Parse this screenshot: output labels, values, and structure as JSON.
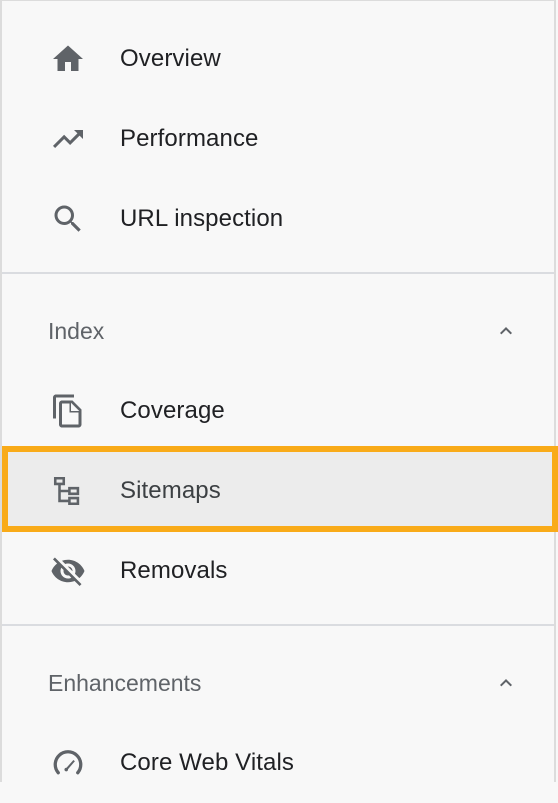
{
  "nav": {
    "top_items": [
      {
        "label": "Overview",
        "icon": "home-icon"
      },
      {
        "label": "Performance",
        "icon": "trending-up-icon"
      },
      {
        "label": "URL inspection",
        "icon": "search-icon"
      }
    ],
    "index_section": {
      "title": "Index",
      "items": [
        {
          "label": "Coverage",
          "icon": "copy-pages-icon"
        },
        {
          "label": "Sitemaps",
          "icon": "sitemap-icon",
          "selected": true
        },
        {
          "label": "Removals",
          "icon": "eye-off-icon"
        }
      ]
    },
    "enhancements_section": {
      "title": "Enhancements",
      "items": [
        {
          "label": "Core Web Vitals",
          "icon": "speedometer-icon"
        }
      ]
    }
  },
  "colors": {
    "highlight": "#f9ab19",
    "icon": "#5f6368",
    "text": "#202124"
  }
}
